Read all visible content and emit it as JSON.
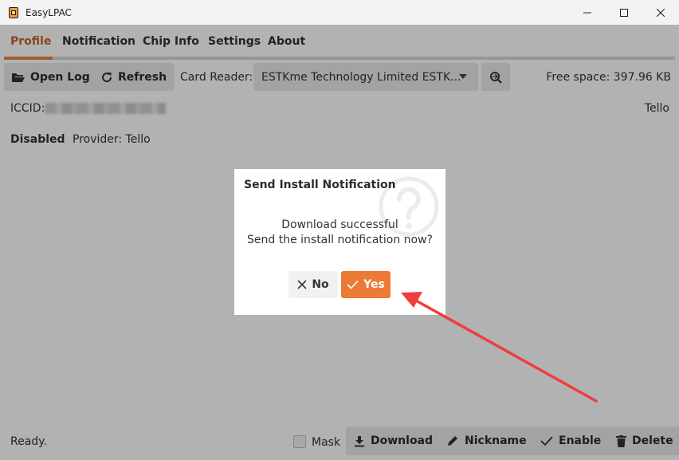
{
  "window": {
    "title": "EasyLPAC",
    "minimize_icon": "minimize-icon",
    "maximize_icon": "maximize-icon",
    "close_icon": "close-icon"
  },
  "tabs": [
    {
      "label": "Profile",
      "active": true
    },
    {
      "label": "Notification",
      "active": false
    },
    {
      "label": "Chip Info",
      "active": false
    },
    {
      "label": "Settings",
      "active": false
    },
    {
      "label": "About",
      "active": false
    }
  ],
  "toolbar": {
    "open_log": "Open Log",
    "refresh": "Refresh",
    "card_reader_label": "Card Reader:",
    "card_reader_value": "ESTKme Technology Limited ESTK...",
    "free_space": "Free space: 397.96 KB"
  },
  "profile": {
    "iccid_label": "ICCID:",
    "nickname": "Tello",
    "state": "Disabled",
    "provider": "Provider: Tello"
  },
  "status": {
    "text": "Ready."
  },
  "bottom_bar": {
    "mask_label": "Mask",
    "download": "Download",
    "nickname": "Nickname",
    "enable": "Enable",
    "delete": "Delete"
  },
  "dialog": {
    "title": "Send Install Notification",
    "line1": "Download successful",
    "line2": "Send the install notification now?",
    "no_label": "No",
    "yes_label": "Yes"
  },
  "colors": {
    "accent": "#e8843f",
    "yes_button": "#ea7a35",
    "annotation_arrow": "#ee3e3e"
  }
}
